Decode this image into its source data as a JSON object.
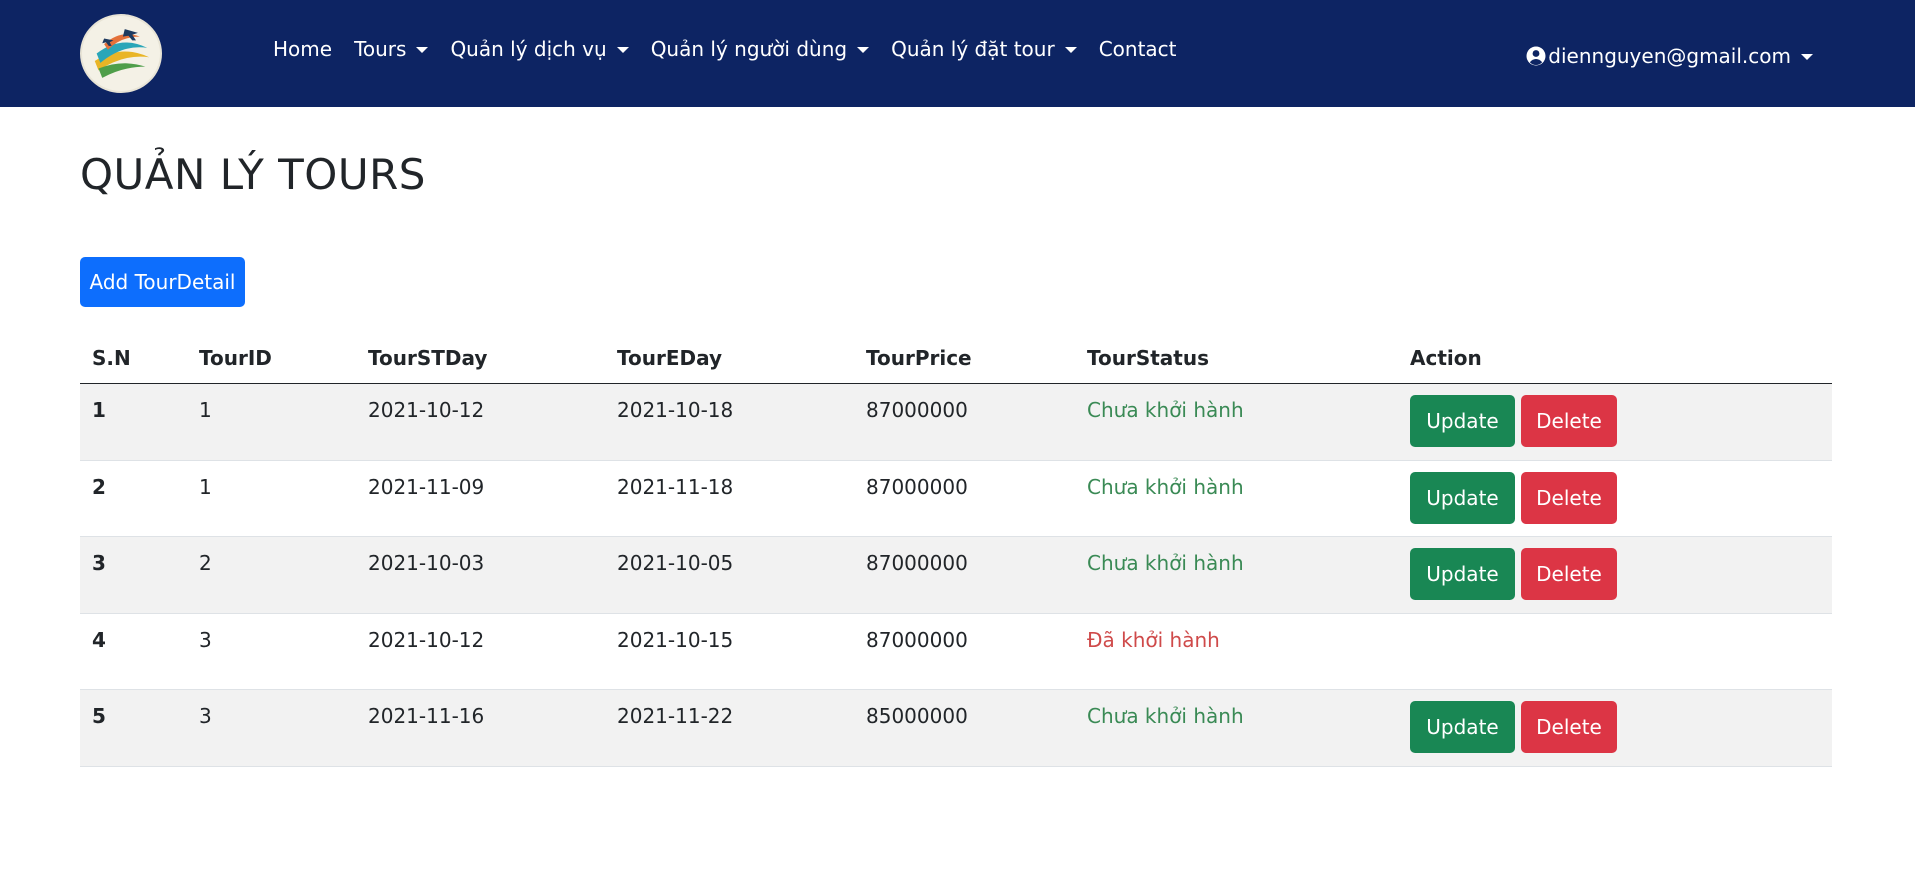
{
  "brand": {
    "logo_icon": "airplane-globe-logo"
  },
  "nav": {
    "items": [
      {
        "label": "Home",
        "dropdown": false
      },
      {
        "label": "Tours",
        "dropdown": true
      },
      {
        "label": "Quản lý dịch vụ",
        "dropdown": true
      },
      {
        "label": "Quản lý người dùng",
        "dropdown": true
      },
      {
        "label": "Quản lý đặt tour",
        "dropdown": true
      },
      {
        "label": "Contact",
        "dropdown": false
      }
    ],
    "user": {
      "email": "diennguyen@gmail.com",
      "icon": "user-circle-icon"
    }
  },
  "page": {
    "title": "QUẢN LÝ TOURS",
    "add_button": "Add TourDetail"
  },
  "table": {
    "headers": [
      "S.N",
      "TourID",
      "TourSTDay",
      "TourEDay",
      "TourPrice",
      "TourStatus",
      "Action"
    ],
    "update_label": "Update",
    "delete_label": "Delete",
    "rows": [
      {
        "sn": "1",
        "tour_id": "1",
        "start": "2021-10-12",
        "end": "2021-10-18",
        "price": "87000000",
        "status": "Chưa khởi hành",
        "status_type": "pending",
        "actions": true
      },
      {
        "sn": "2",
        "tour_id": "1",
        "start": "2021-11-09",
        "end": "2021-11-18",
        "price": "87000000",
        "status": "Chưa khởi hành",
        "status_type": "pending",
        "actions": true
      },
      {
        "sn": "3",
        "tour_id": "2",
        "start": "2021-10-03",
        "end": "2021-10-05",
        "price": "87000000",
        "status": "Chưa khởi hành",
        "status_type": "pending",
        "actions": true
      },
      {
        "sn": "4",
        "tour_id": "3",
        "start": "2021-10-12",
        "end": "2021-10-15",
        "price": "87000000",
        "status": "Đã khởi hành",
        "status_type": "departed",
        "actions": false
      },
      {
        "sn": "5",
        "tour_id": "3",
        "start": "2021-11-16",
        "end": "2021-11-22",
        "price": "85000000",
        "status": "Chưa khởi hành",
        "status_type": "pending",
        "actions": true
      }
    ]
  },
  "colors": {
    "navbar": "#0d2463",
    "primary": "#0d6efd",
    "success": "#198754",
    "danger": "#dc3545",
    "status_pending": "#3a8a55",
    "status_departed": "#cf4a4a"
  }
}
